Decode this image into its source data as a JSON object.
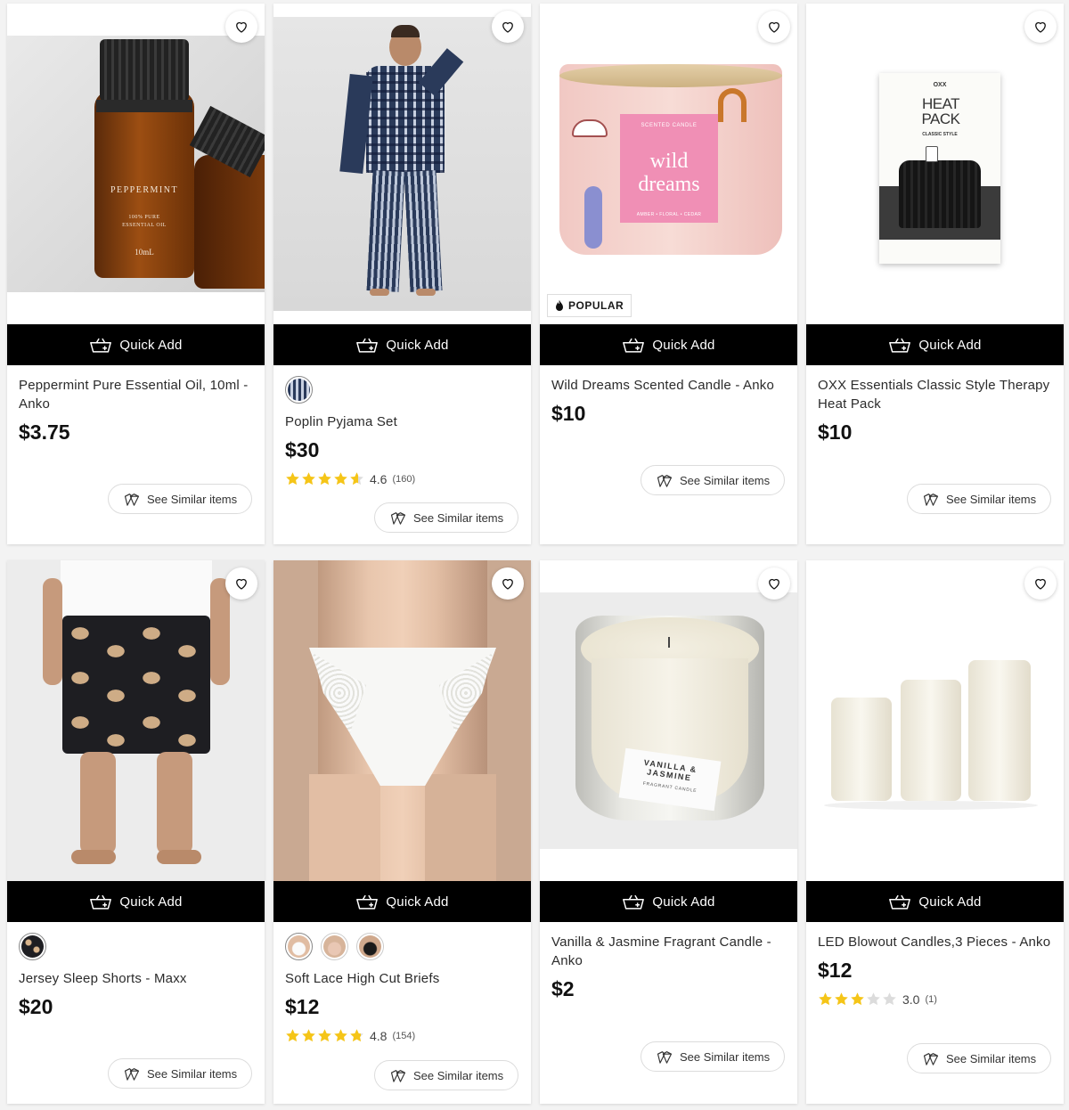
{
  "quick_add_label": "Quick Add",
  "see_similar_label": "See Similar items",
  "products": [
    {
      "title": "Peppermint Pure Essential Oil, 10ml - Anko",
      "price": "$3.75",
      "bottle_label": "PEPPERMINT",
      "bottle_sub": "100% PURE ESSENTIAL OIL",
      "bottle_vol": "10mL"
    },
    {
      "title": "Poplin Pyjama Set",
      "price": "$30",
      "rating": "4.6",
      "reviews": "(160)",
      "stars": 4.6
    },
    {
      "title": "Wild Dreams Scented Candle - Anko",
      "price": "$10",
      "badge": "POPULAR",
      "candle_label_top": "SCENTED CANDLE",
      "candle_label_main": "wild dreams",
      "candle_label_bottom": "AMBER • FLORAL • CEDAR"
    },
    {
      "title": "OXX Essentials Classic Style Therapy Heat Pack",
      "price": "$10",
      "box_brand": "OXX",
      "box_title": "HEAT PACK",
      "box_sub": "CLASSIC STYLE"
    },
    {
      "title": "Jersey Sleep Shorts - Maxx",
      "price": "$20"
    },
    {
      "title": "Soft Lace High Cut Briefs",
      "price": "$12",
      "rating": "4.8",
      "reviews": "(154)",
      "stars": 4.8
    },
    {
      "title": "Vanilla & Jasmine Fragrant Candle - Anko",
      "price": "$2",
      "jar_label": "VANILLA & JASMINE",
      "jar_sub": "FRAGRANT CANDLE"
    },
    {
      "title": "LED Blowout Candles,3 Pieces - Anko",
      "price": "$12",
      "rating": "3.0",
      "reviews": "(1)",
      "stars": 3.0
    }
  ],
  "colors": {
    "star": "#f5c518",
    "star_empty": "#dcdcdc",
    "quick_add_bg": "#000000"
  }
}
